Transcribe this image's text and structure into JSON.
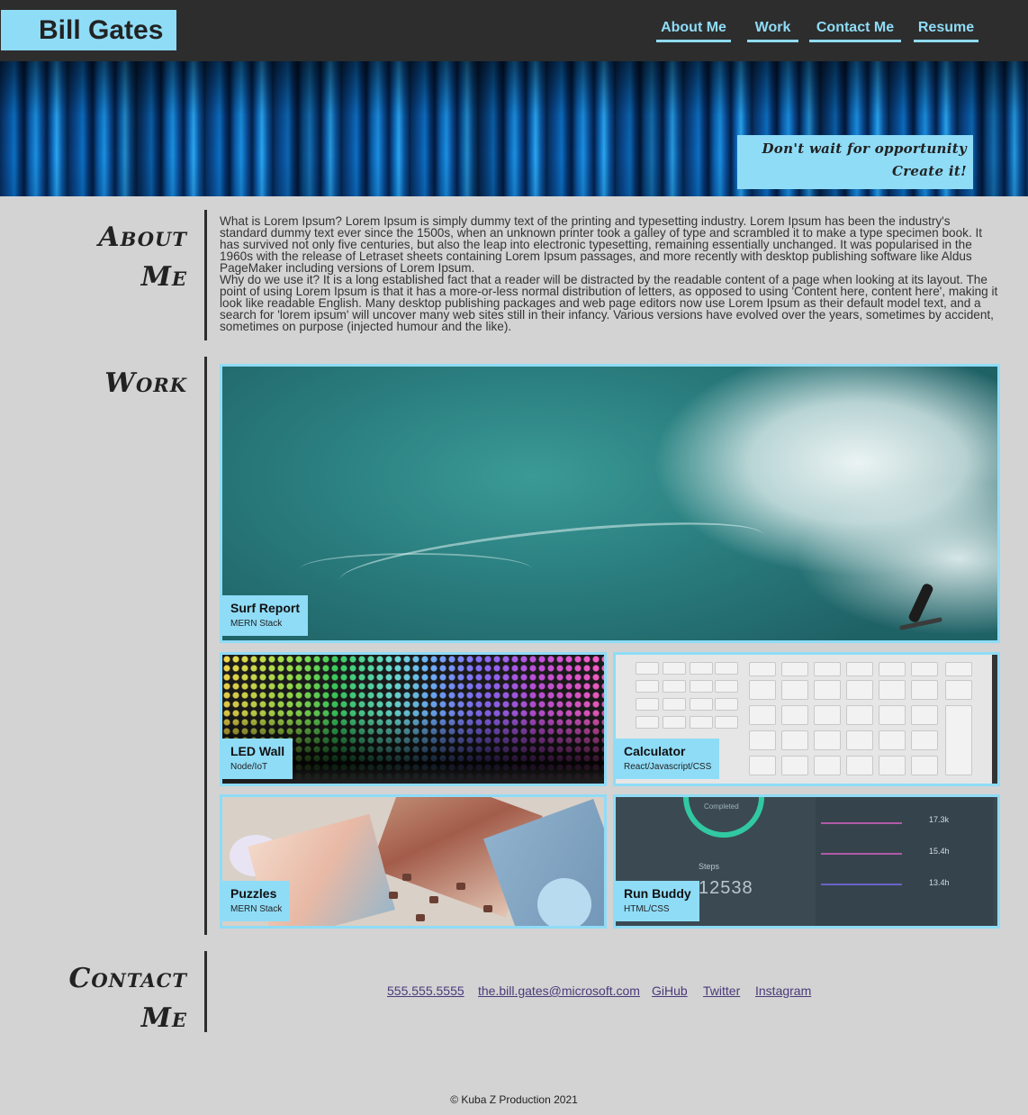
{
  "header": {
    "brand": "Bill Gates",
    "nav": [
      "About Me",
      "Work",
      "Contact Me",
      "Resume"
    ]
  },
  "hero": {
    "tagline_line1": "Don't wait for opportunity",
    "tagline_line2": "Create it!"
  },
  "about": {
    "title_line1": "About",
    "title_line2": "Me",
    "paragraph1": "What is Lorem Ipsum? Lorem Ipsum is simply dummy text of the printing and typesetting industry. Lorem Ipsum has been the industry's standard dummy text ever since the 1500s, when an unknown printer took a galley of type and scrambled it to make a type specimen book. It has survived not only five centuries, but also the leap into electronic typesetting, remaining essentially unchanged. It was popularised in the 1960s with the release of Letraset sheets containing Lorem Ipsum passages, and more recently with desktop publishing software like Aldus PageMaker including versions of Lorem Ipsum.",
    "paragraph2": "Why do we use it? It is a long established fact that a reader will be distracted by the readable content of a page when looking at its layout. The point of using Lorem Ipsum is that it has a more-or-less normal distribution of letters, as opposed to using 'Content here, content here', making it look like readable English. Many desktop publishing packages and web page editors now use Lorem Ipsum as their default model text, and a search for 'lorem ipsum' will uncover many web sites still in their infancy. Various versions have evolved over the years, sometimes by accident, sometimes on purpose (injected humour and the like)."
  },
  "work": {
    "title": "Work",
    "projects": [
      {
        "name": "Surf Report",
        "stack": "MERN Stack"
      },
      {
        "name": "LED Wall",
        "stack": "Node/IoT"
      },
      {
        "name": "Calculator",
        "stack": "React/Javascript/CSS"
      },
      {
        "name": "Puzzles",
        "stack": "MERN Stack"
      },
      {
        "name": "Run Buddy",
        "stack": "HTML/CSS"
      }
    ],
    "run_buddy_screen": {
      "completed": "Completed",
      "steps_label": "Steps",
      "steps_value": "12538",
      "stats": [
        "17.3k",
        "15.4h",
        "13.4h"
      ]
    }
  },
  "contact": {
    "title_line1": "Contact",
    "title_line2": "Me",
    "links": [
      "555.555.5555",
      "the.bill.gates@microsoft.com",
      "GiHub",
      "Twitter",
      "Instagram"
    ]
  },
  "footer": {
    "text": "© Kuba Z Production 2021"
  },
  "colors": {
    "accent": "#8fdcf7",
    "header_bg": "#2d2d2d",
    "page_bg": "#d3d3d3",
    "link": "#4a3a7a"
  }
}
